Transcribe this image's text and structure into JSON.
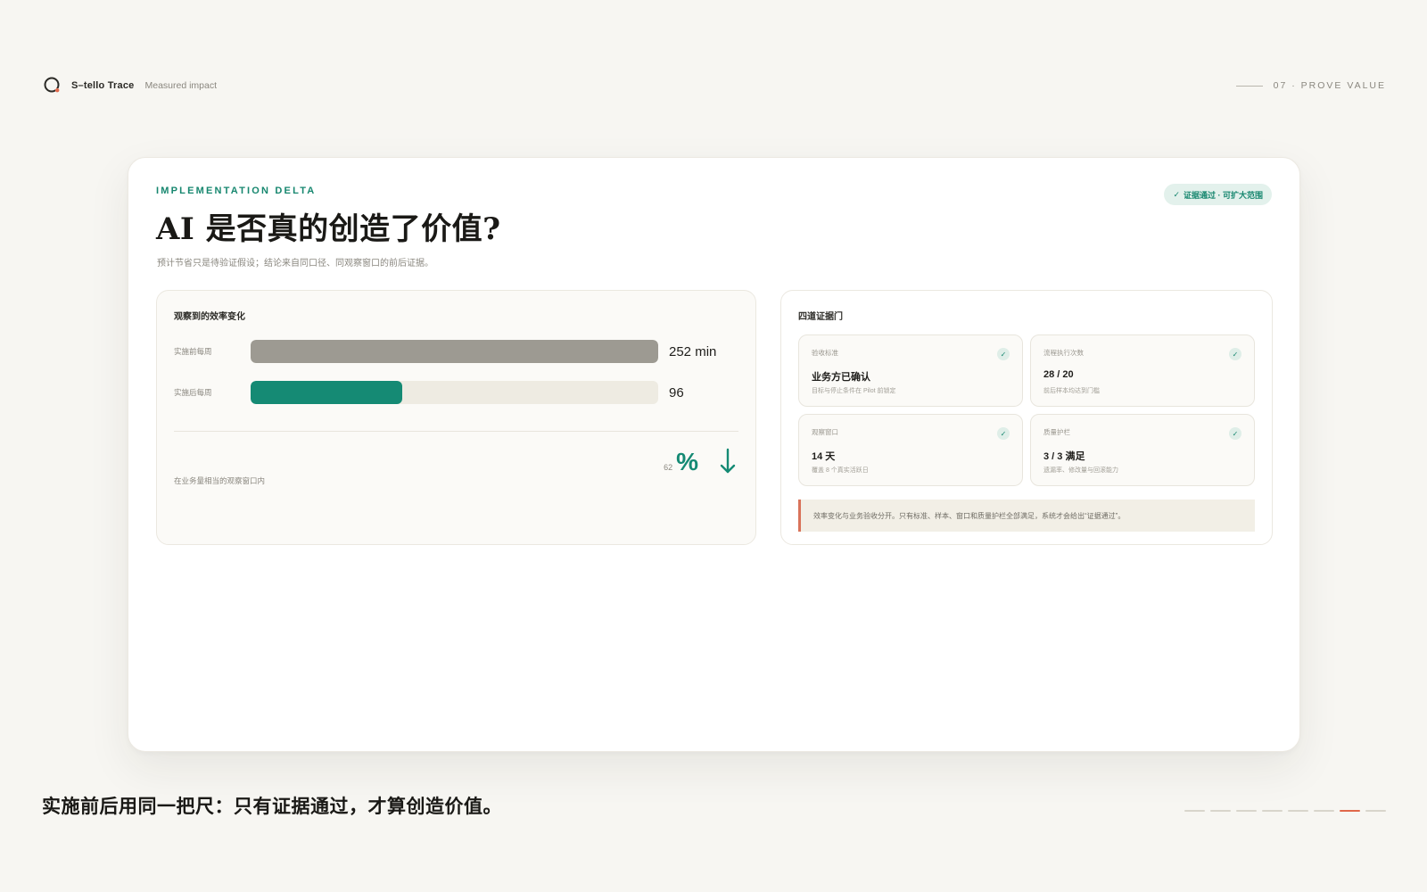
{
  "brand": {
    "name": "S–tello Trace",
    "subtitle": "Measured impact",
    "accent": "#e0684a"
  },
  "section_tag": "07 · PROVE VALUE",
  "card": {
    "eyebrow": "IMPLEMENTATION DELTA",
    "title": "AI 是否真的创造了价值?",
    "subtitle": "预计节省只是待验证假设；结论来自同口径、同观察窗口的前后证据。",
    "status_chip": "证据通过 · 可扩大范围"
  },
  "efficiency": {
    "title": "观察到的效率变化",
    "bars": [
      {
        "label": "实施前每周",
        "value": "252 min",
        "fill_fraction": 1.0
      },
      {
        "label": "实施后每周",
        "value": "96",
        "fill_fraction": 0.372
      }
    ],
    "note": "在业务量相当的观察窗口内",
    "metric_value": "62",
    "metric_unit": "%",
    "metric_direction": "arrow-down-icon",
    "colors": {
      "before": "#9d9a92",
      "after": "#158a74"
    }
  },
  "gates": {
    "title": "四道证据门",
    "items": [
      {
        "label": "验收标准",
        "value": "业务方已确认",
        "desc": "目标与停止条件在 Pilot 前锁定",
        "status": "check-icon"
      },
      {
        "label": "流程执行次数",
        "value": "28 / 20",
        "desc": "前后样本均达到门槛",
        "status": "check-icon"
      },
      {
        "label": "观察窗口",
        "value": "14 天",
        "desc": "覆盖 8 个真实活跃日",
        "status": "check-icon"
      },
      {
        "label": "质量护栏",
        "value": "3 / 3 满足",
        "desc": "遗漏率、修改量与回滚能力",
        "status": "check-icon"
      }
    ],
    "callout": "效率变化与业务验收分开。只有标准、样本、窗口和质量护栏全部满足，系统才会给出“证据通过”。"
  },
  "caption": "实施前后用同一把尺：只有证据通过，才算创造价值。",
  "pager": {
    "total": 8,
    "active_index": 6
  }
}
